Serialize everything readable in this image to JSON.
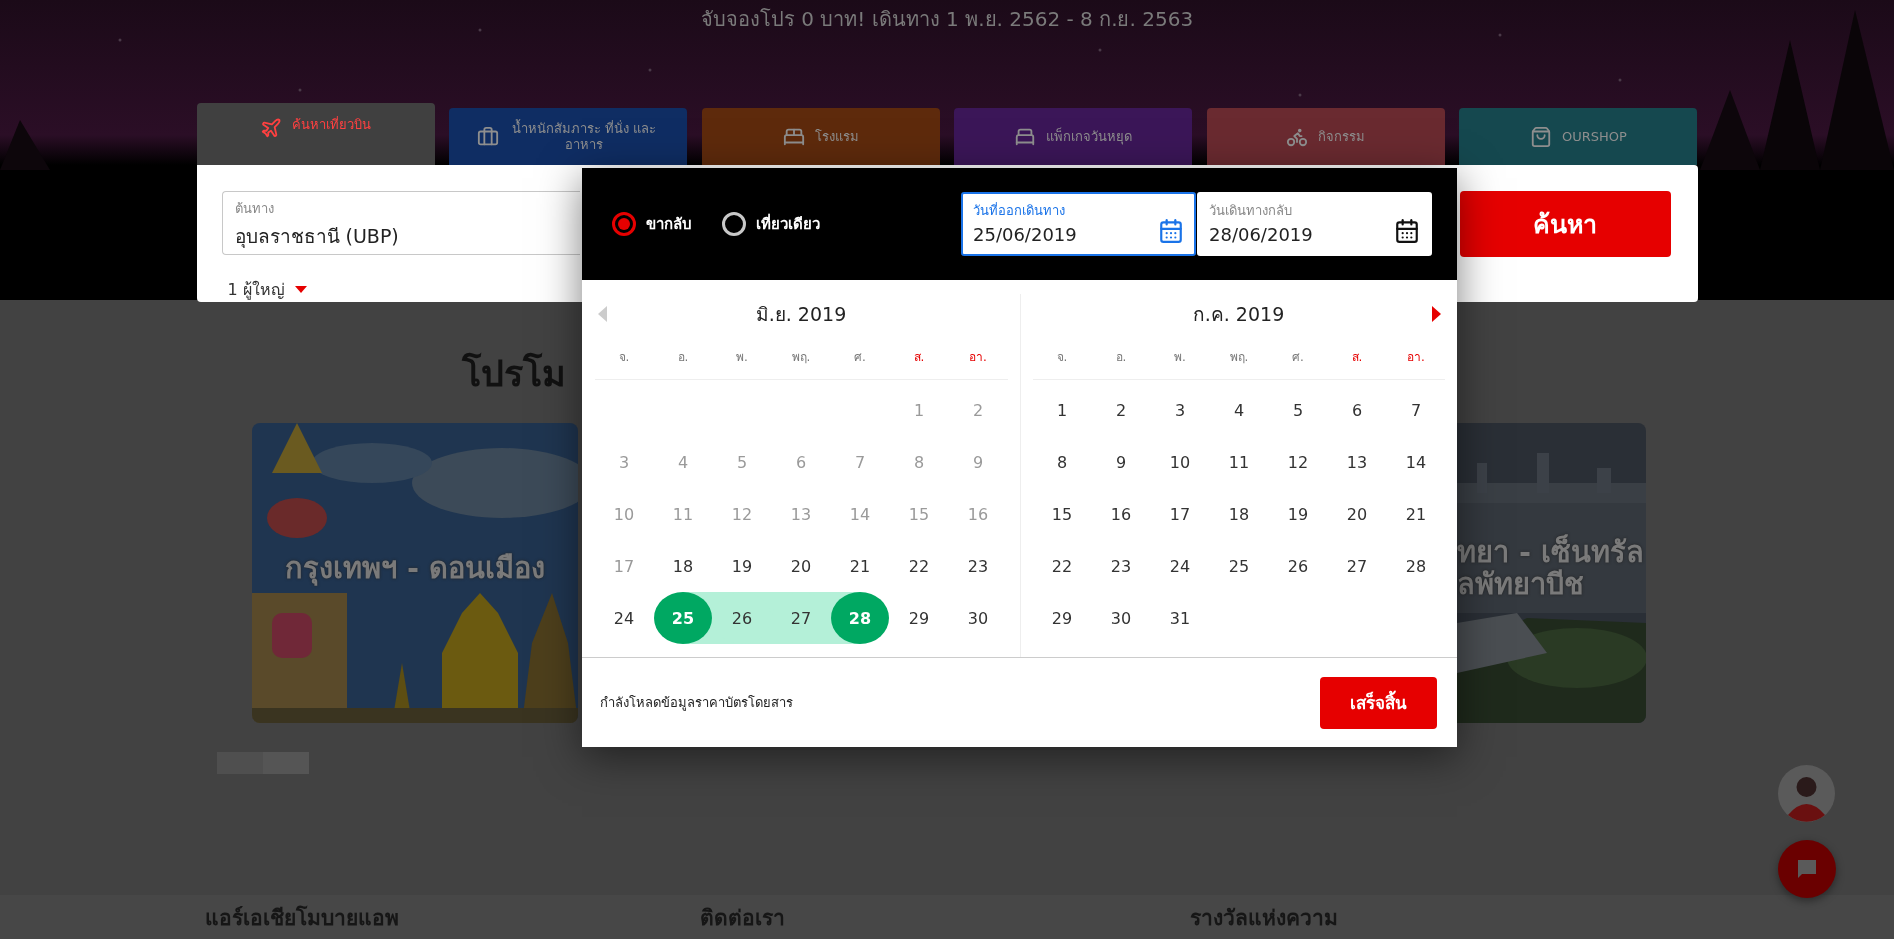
{
  "hero": {
    "headline": "จับจองโปร 0 บาท! เดินทาง 1 พ.ย. 2562 - 8 ก.ย. 2563"
  },
  "tabs": [
    {
      "label": "ค้นหาเที่ยวบิน",
      "selected": true,
      "color": "#ff4040"
    },
    {
      "label": "น้ำหนักสัมภาระ ที่นั่ง และ อาหาร",
      "selected": false,
      "color": "#0f2d63"
    },
    {
      "label": "โรงแรม",
      "selected": false,
      "color": "#5e2a0c"
    },
    {
      "label": "แพ็กเกจวันหยุด",
      "selected": false,
      "color": "#3b1658"
    },
    {
      "label": "กิจกรรม",
      "selected": false,
      "color": "#6a2a30"
    },
    {
      "label": "OURSHOP",
      "selected": false,
      "color": "#15484f"
    }
  ],
  "search_form": {
    "origin": {
      "label": "ต้นทาง",
      "value": "อุบลราชธานี (UBP)"
    },
    "passengers": "1 ผู้ใหญ่",
    "search_button": "ค้นหา"
  },
  "promotions": {
    "heading": "โปรโม",
    "cards": [
      {
        "lines": [
          "กรุงเทพฯ - ดอนเมือง"
        ]
      },
      {
        "lines": [
          "ทยา - เซ็นทรัล",
          "ลพัทยาบีช"
        ]
      }
    ]
  },
  "date_picker": {
    "trip_types": [
      {
        "label": "ขากลับ",
        "selected": true
      },
      {
        "label": "เที่ยวเดียว",
        "selected": false
      }
    ],
    "departure": {
      "label": "วันที่ออกเดินทาง",
      "value": "25/06/2019",
      "focused": true
    },
    "return": {
      "label": "วันเดินทางกลับ",
      "value": "28/06/2019",
      "focused": false
    },
    "prev_button": {
      "disabled": true
    },
    "next_button": {
      "disabled": false
    },
    "months": [
      {
        "title": "มิ.ย. 2019",
        "weekdays": [
          {
            "label": "จ.",
            "weekend": false
          },
          {
            "label": "อ.",
            "weekend": false
          },
          {
            "label": "พ.",
            "weekend": false
          },
          {
            "label": "พฤ.",
            "weekend": false
          },
          {
            "label": "ศ.",
            "weekend": false
          },
          {
            "label": "ส.",
            "weekend": true
          },
          {
            "label": "อา.",
            "weekend": true
          }
        ],
        "kind": "offset_start",
        "weeks": [
          [
            {
              "label": "1",
              "disabled": true,
              "selected": false,
              "in_range": false
            },
            {
              "label": "2",
              "disabled": true,
              "selected": false,
              "in_range": false
            }
          ],
          [
            {
              "label": "3",
              "disabled": true,
              "selected": false,
              "in_range": false
            },
            {
              "label": "4",
              "disabled": true,
              "selected": false,
              "in_range": false
            },
            {
              "label": "5",
              "disabled": true,
              "selected": false,
              "in_range": false
            },
            {
              "label": "6",
              "disabled": true,
              "selected": false,
              "in_range": false
            },
            {
              "label": "7",
              "disabled": true,
              "selected": false,
              "in_range": false
            },
            {
              "label": "8",
              "disabled": true,
              "selected": false,
              "in_range": false
            },
            {
              "label": "9",
              "disabled": true,
              "selected": false,
              "in_range": false
            }
          ],
          [
            {
              "label": "10",
              "disabled": true,
              "selected": false,
              "in_range": false
            },
            {
              "label": "11",
              "disabled": true,
              "selected": false,
              "in_range": false
            },
            {
              "label": "12",
              "disabled": true,
              "selected": false,
              "in_range": false
            },
            {
              "label": "13",
              "disabled": true,
              "selected": false,
              "in_range": false
            },
            {
              "label": "14",
              "disabled": true,
              "selected": false,
              "in_range": false
            },
            {
              "label": "15",
              "disabled": true,
              "selected": false,
              "in_range": false
            },
            {
              "label": "16",
              "disabled": true,
              "selected": false,
              "in_range": false
            }
          ],
          [
            {
              "label": "17",
              "disabled": true,
              "selected": false,
              "in_range": false
            },
            {
              "label": "18",
              "disabled": false,
              "selected": false,
              "in_range": false
            },
            {
              "label": "19",
              "disabled": false,
              "selected": false,
              "in_range": false
            },
            {
              "label": "20",
              "disabled": false,
              "selected": false,
              "in_range": false
            },
            {
              "label": "21",
              "disabled": false,
              "selected": false,
              "in_range": false
            },
            {
              "label": "22",
              "disabled": false,
              "selected": false,
              "in_range": false
            },
            {
              "label": "23",
              "disabled": false,
              "selected": false,
              "in_range": false
            }
          ],
          [
            {
              "label": "24",
              "disabled": false,
              "selected": false,
              "in_range": false
            },
            {
              "label": "25",
              "disabled": false,
              "selected": true,
              "in_range": true
            },
            {
              "label": "26",
              "disabled": false,
              "selected": false,
              "in_range": true
            },
            {
              "label": "27",
              "disabled": false,
              "selected": false,
              "in_range": true
            },
            {
              "label": "28",
              "disabled": false,
              "selected": true,
              "in_range": true
            },
            {
              "label": "29",
              "disabled": false,
              "selected": false,
              "in_range": false
            },
            {
              "label": "30",
              "disabled": false,
              "selected": false,
              "in_range": false
            }
          ]
        ]
      },
      {
        "title": "ก.ค. 2019",
        "kind": "monday_start",
        "weekdays": [
          {
            "label": "จ.",
            "weekend": false
          },
          {
            "label": "อ.",
            "weekend": false
          },
          {
            "label": "พ.",
            "weekend": false
          },
          {
            "label": "พฤ.",
            "weekend": false
          },
          {
            "label": "ศ.",
            "weekend": false
          },
          {
            "label": "ส.",
            "weekend": true
          },
          {
            "label": "อา.",
            "weekend": true
          }
        ],
        "weeks": [
          [
            {
              "label": "1",
              "disabled": false,
              "selected": false,
              "in_range": false
            },
            {
              "label": "2",
              "disabled": false,
              "selected": false,
              "in_range": false
            },
            {
              "label": "3",
              "disabled": false,
              "selected": false,
              "in_range": false
            },
            {
              "label": "4",
              "disabled": false,
              "selected": false,
              "in_range": false
            },
            {
              "label": "5",
              "disabled": false,
              "selected": false,
              "in_range": false
            },
            {
              "label": "6",
              "disabled": false,
              "selected": false,
              "in_range": false
            },
            {
              "label": "7",
              "disabled": false,
              "selected": false,
              "in_range": false
            }
          ],
          [
            {
              "label": "8",
              "disabled": false,
              "selected": false,
              "in_range": false
            },
            {
              "label": "9",
              "disabled": false,
              "selected": false,
              "in_range": false
            },
            {
              "label": "10",
              "disabled": false,
              "selected": false,
              "in_range": false
            },
            {
              "label": "11",
              "disabled": false,
              "selected": false,
              "in_range": false
            },
            {
              "label": "12",
              "disabled": false,
              "selected": false,
              "in_range": false
            },
            {
              "label": "13",
              "disabled": false,
              "selected": false,
              "in_range": false
            },
            {
              "label": "14",
              "disabled": false,
              "selected": false,
              "in_range": false
            }
          ],
          [
            {
              "label": "15",
              "disabled": false,
              "selected": false,
              "in_range": false
            },
            {
              "label": "16",
              "disabled": false,
              "selected": false,
              "in_range": false
            },
            {
              "label": "17",
              "disabled": false,
              "selected": false,
              "in_range": false
            },
            {
              "label": "18",
              "disabled": false,
              "selected": false,
              "in_range": false
            },
            {
              "label": "19",
              "disabled": false,
              "selected": false,
              "in_range": false
            },
            {
              "label": "20",
              "disabled": false,
              "selected": false,
              "in_range": false
            },
            {
              "label": "21",
              "disabled": false,
              "selected": false,
              "in_range": false
            }
          ],
          [
            {
              "label": "22",
              "disabled": false,
              "selected": false,
              "in_range": false
            },
            {
              "label": "23",
              "disabled": false,
              "selected": false,
              "in_range": false
            },
            {
              "label": "24",
              "disabled": false,
              "selected": false,
              "in_range": false
            },
            {
              "label": "25",
              "disabled": false,
              "selected": false,
              "in_range": false
            },
            {
              "label": "26",
              "disabled": false,
              "selected": false,
              "in_range": false
            },
            {
              "label": "27",
              "disabled": false,
              "selected": false,
              "in_range": false
            },
            {
              "label": "28",
              "disabled": false,
              "selected": false,
              "in_range": false
            }
          ],
          [
            {
              "label": "29",
              "disabled": false,
              "selected": false,
              "in_range": false
            },
            {
              "label": "30",
              "disabled": false,
              "selected": false,
              "in_range": false
            },
            {
              "label": "31",
              "disabled": false,
              "selected": false,
              "in_range": false
            }
          ]
        ]
      }
    ],
    "status": "กำลังโหลดข้อมูลราคาบัตรโดยสาร",
    "done_button": "เสร็จสิ้น"
  },
  "footer": {
    "headings": [
      "แอร์เอเชียโมบายแอพ",
      "ติดต่อเรา",
      "รางวัลแห่งความ"
    ]
  }
}
